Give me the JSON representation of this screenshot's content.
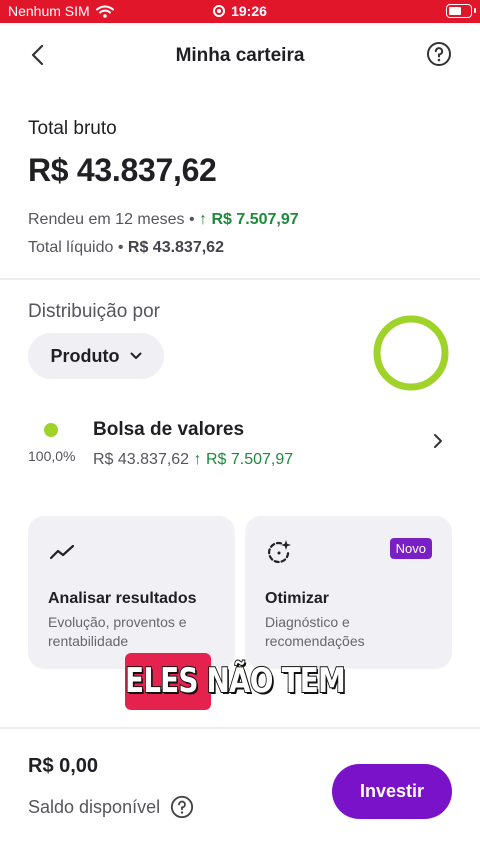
{
  "status_bar": {
    "carrier": "Nenhum SIM",
    "time": "19:26"
  },
  "header": {
    "title": "Minha carteira"
  },
  "summary": {
    "label": "Total bruto",
    "amount": "R$ 43.837,62",
    "yield_label": "Rendeu em 12 meses •",
    "yield_value": "R$ 7.507,97",
    "net_label": "Total líquido •",
    "net_value": "R$ 43.837,62"
  },
  "distribution": {
    "label": "Distribuição por",
    "selected": "Produto",
    "chart_color": "#9fd32a",
    "items": [
      {
        "name": "Bolsa de valores",
        "percent": "100,0%",
        "value": "R$ 43.837,62",
        "gain": "R$ 7.507,97",
        "color": "#9fd32a"
      }
    ]
  },
  "cards": [
    {
      "title": "Analisar resultados",
      "desc": "Evolução, proventos e rentabilidade",
      "icon": "trend-chart-icon"
    },
    {
      "title": "Otimizar",
      "desc": "Diagnóstico e recomendações",
      "icon": "sparkle-target-icon",
      "badge": "Novo"
    }
  ],
  "caption": {
    "text": "ELES NÃO TEM"
  },
  "footer": {
    "amount": "R$ 0,00",
    "balance_label": "Saldo disponível",
    "invest_label": "Investir"
  },
  "colors": {
    "brand_red": "#e1162b",
    "accent_purple": "#7a12c9",
    "gain_green": "#1e8a3c"
  }
}
